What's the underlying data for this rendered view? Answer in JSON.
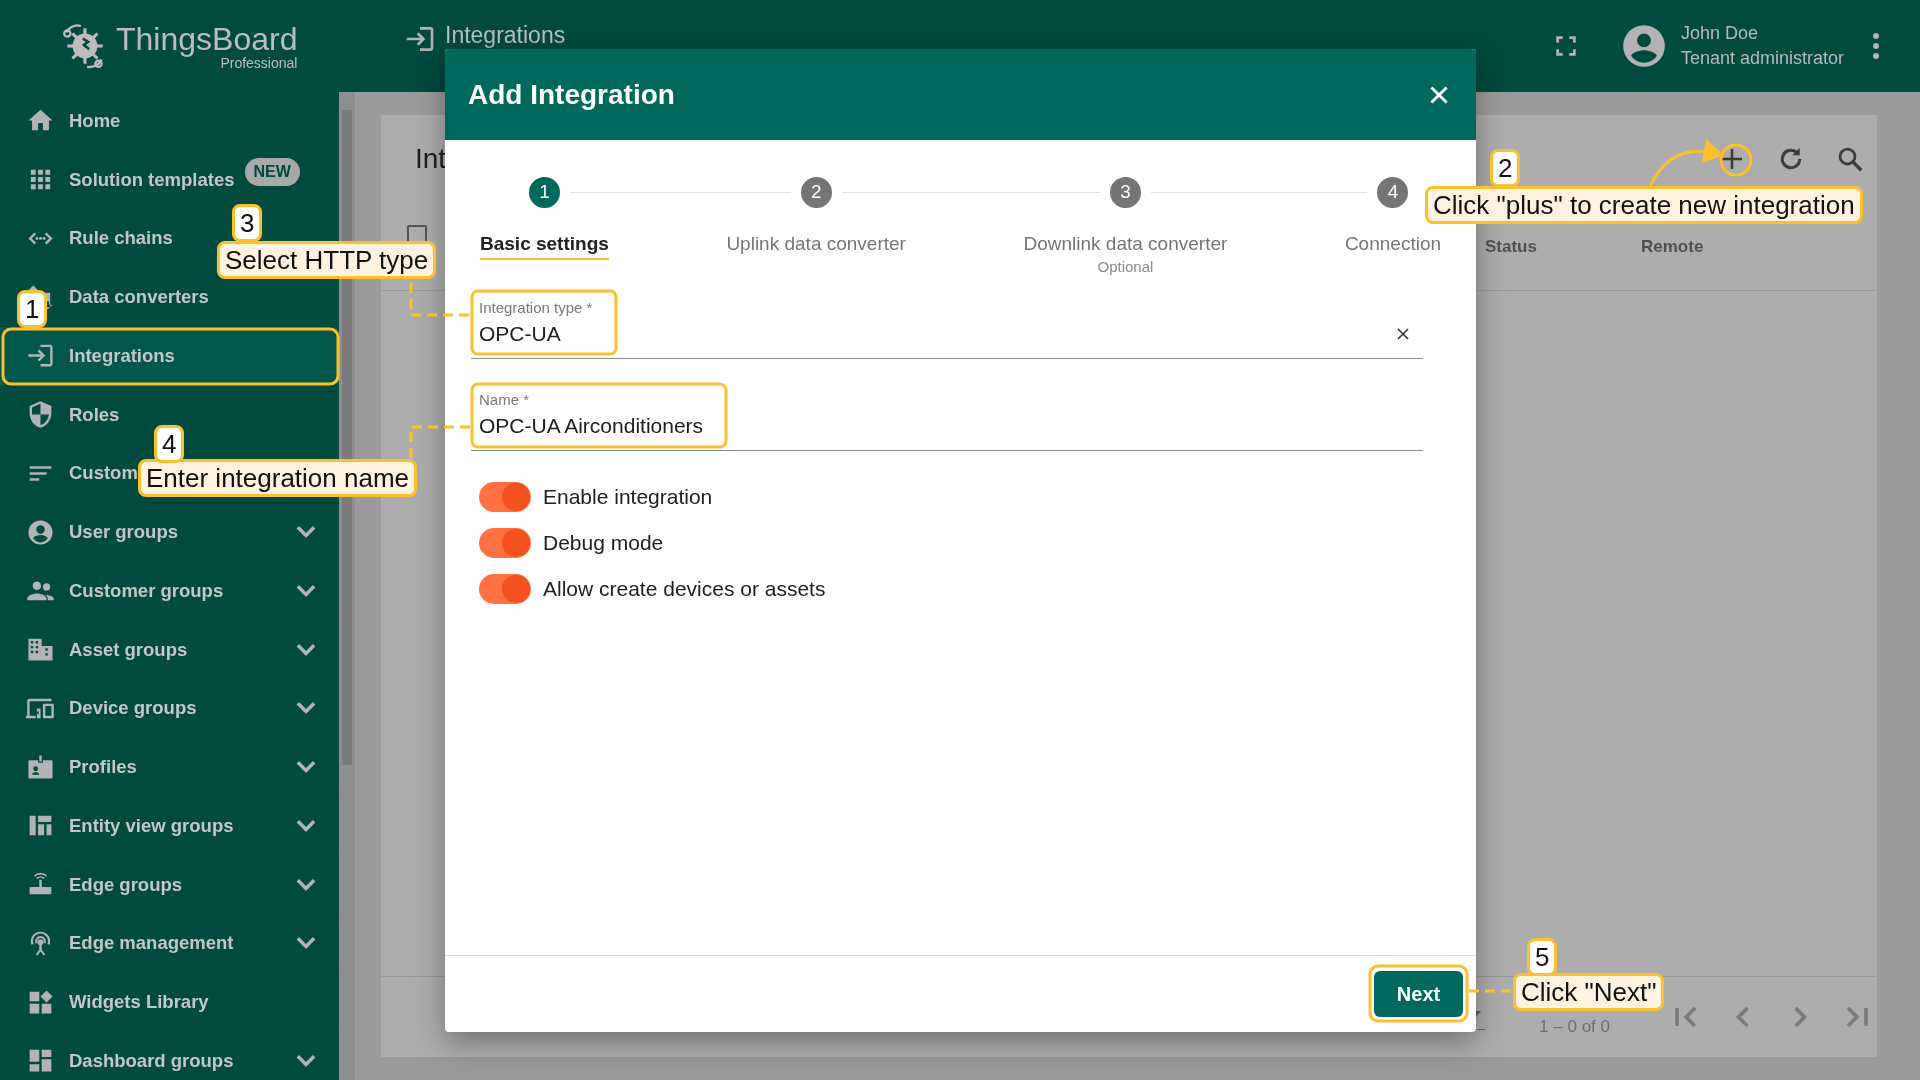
{
  "app": {
    "logo_title": "ThingsBoard",
    "logo_subtitle": "Professional"
  },
  "sidebar": {
    "items": [
      {
        "label": "Home",
        "selected": false,
        "expandable": false
      },
      {
        "label": "Solution templates",
        "badge": "NEW",
        "selected": false,
        "expandable": false
      },
      {
        "label": "Rule chains",
        "selected": false,
        "expandable": false
      },
      {
        "label": "Data converters",
        "selected": false,
        "expandable": false
      },
      {
        "label": "Integrations",
        "selected": true,
        "expandable": false
      },
      {
        "label": "Roles",
        "selected": false,
        "expandable": false
      },
      {
        "label": "Custom",
        "selected": false
      },
      {
        "label": "User groups",
        "selected": false,
        "expandable": true
      },
      {
        "label": "Customer groups",
        "selected": false,
        "expandable": true
      },
      {
        "label": "Asset groups",
        "selected": false,
        "expandable": true
      },
      {
        "label": "Device groups",
        "selected": false,
        "expandable": true
      },
      {
        "label": "Profiles",
        "selected": false,
        "expandable": true
      },
      {
        "label": "Entity view groups",
        "selected": false,
        "expandable": true
      },
      {
        "label": "Edge groups",
        "selected": false,
        "expandable": true
      },
      {
        "label": "Edge management",
        "selected": false,
        "expandable": true
      },
      {
        "label": "Widgets Library",
        "selected": false,
        "expandable": false
      },
      {
        "label": "Dashboard groups",
        "selected": false,
        "expandable": true
      }
    ]
  },
  "header": {
    "page_title": "Integrations",
    "user_name": "John Doe",
    "user_role": "Tenant administrator"
  },
  "card": {
    "title": "Int",
    "select_all": {
      "checked": false
    },
    "columns": [
      "Status",
      "Remote"
    ],
    "paginator": "1 – 0 of 0"
  },
  "dialog": {
    "title": "Add Integration",
    "steps": [
      {
        "number": "1",
        "label": "Basic settings",
        "selected": true
      },
      {
        "number": "2",
        "label": "Uplink data converter",
        "selected": false
      },
      {
        "number": "3",
        "label": "Downlink data converter",
        "sublabel": "Optional",
        "selected": false
      },
      {
        "number": "4",
        "label": "Connection",
        "selected": false
      }
    ],
    "fields": [
      {
        "label": "Integration type *",
        "value": "OPC-UA",
        "clear_button": true
      },
      {
        "label": "Name *",
        "value": "OPC-UA Airconditioners",
        "clear_button": false
      }
    ],
    "toggles": [
      {
        "label": "Enable integration",
        "on": true
      },
      {
        "label": "Debug mode",
        "on": true
      },
      {
        "label": "Allow create devices or assets",
        "on": true
      }
    ],
    "button": "Next"
  },
  "callouts": [
    {
      "number": "1"
    },
    {
      "number": "2",
      "text": "Click \"plus\" to create new integration"
    },
    {
      "number": "3",
      "text": "Select HTTP type"
    },
    {
      "number": "4",
      "text": "Enter integration name"
    },
    {
      "number": "5",
      "text": "Click \"Next\""
    }
  ]
}
